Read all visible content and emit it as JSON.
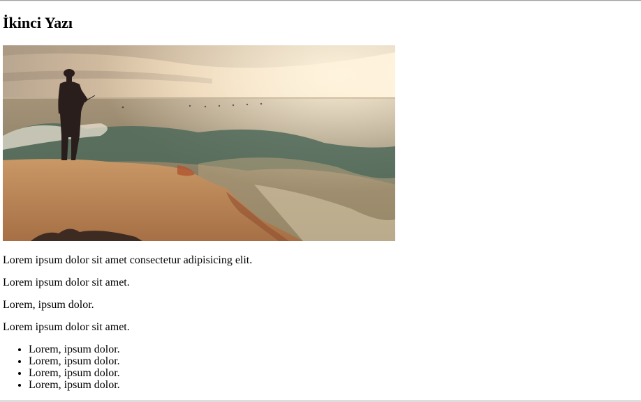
{
  "article": {
    "title": "İkinci Yazı",
    "image_alt": "",
    "paragraphs": [
      "Lorem ipsum dolor sit amet consectetur adipisicing elit.",
      "Lorem ipsum dolor sit amet.",
      "Lorem, ipsum dolor.",
      "Lorem ipsum dolor sit amet."
    ],
    "list_items": [
      "Lorem, ipsum dolor.",
      "Lorem, ipsum dolor.",
      "Lorem, ipsum dolor.",
      "Lorem, ipsum dolor."
    ]
  },
  "colors": {
    "sky_top": "#c9b8a2",
    "sky_glow": "#fbe6c4",
    "sea": "#8a7a5e",
    "wave": "#4f6a5a",
    "rock": "#c48e5c",
    "silhouette": "#2a1e1c"
  }
}
